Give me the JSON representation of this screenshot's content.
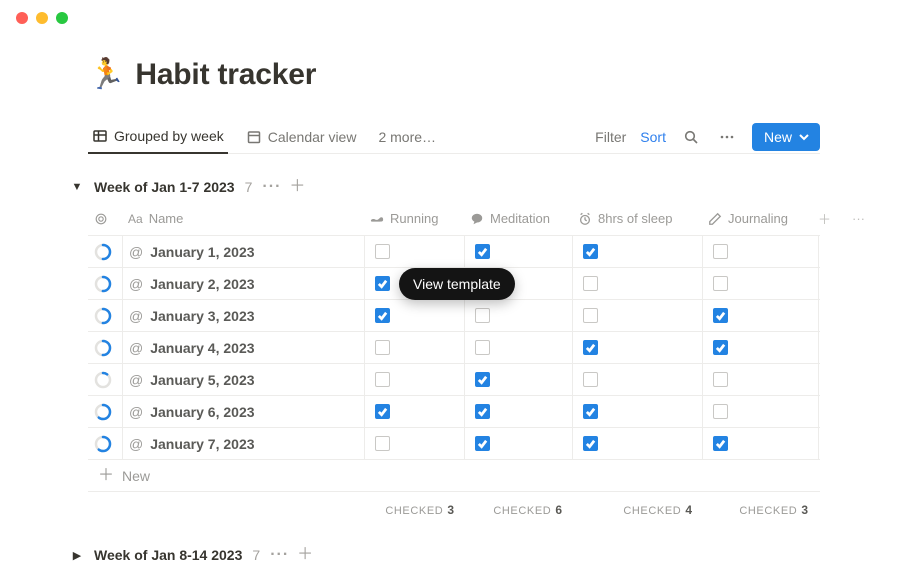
{
  "window": {
    "mac_buttons": true
  },
  "page": {
    "emoji": "🏃",
    "title": "Habit tracker"
  },
  "tabs": {
    "active": {
      "label": "Grouped by week"
    },
    "second": {
      "label": "Calendar view"
    },
    "more": {
      "label": "2 more…"
    }
  },
  "toolbar": {
    "filter": "Filter",
    "sort": "Sort",
    "new": "New"
  },
  "groups": [
    {
      "title": "Week of Jan 1-7 2023",
      "count": "7",
      "expanded": true,
      "columns": {
        "name": "Name",
        "running": "Running",
        "meditation": "Meditation",
        "sleep": "8hrs of sleep",
        "journaling": "Journaling"
      },
      "rows": [
        {
          "date": "January 1, 2023",
          "progress": 0.5,
          "running": false,
          "meditation": true,
          "sleep": true,
          "journaling": false
        },
        {
          "date": "January 2, 2023",
          "progress": 0.5,
          "running": true,
          "meditation": true,
          "sleep": false,
          "journaling": false
        },
        {
          "date": "January 3, 2023",
          "progress": 0.5,
          "running": true,
          "meditation": false,
          "sleep": false,
          "journaling": true
        },
        {
          "date": "January 4, 2023",
          "progress": 0.5,
          "running": false,
          "meditation": false,
          "sleep": true,
          "journaling": true
        },
        {
          "date": "January 5, 2023",
          "progress": 0.1,
          "running": false,
          "meditation": true,
          "sleep": false,
          "journaling": false
        },
        {
          "date": "January 6, 2023",
          "progress": 0.6,
          "running": true,
          "meditation": true,
          "sleep": true,
          "journaling": false
        },
        {
          "date": "January 7, 2023",
          "progress": 0.6,
          "running": false,
          "meditation": true,
          "sleep": true,
          "journaling": true
        }
      ],
      "new_row_label": "New",
      "footers": {
        "label": "CHECKED",
        "running": "3",
        "meditation": "6",
        "sleep": "4",
        "journaling": "3"
      }
    },
    {
      "title": "Week of Jan 8-14 2023",
      "count": "7",
      "expanded": false
    }
  ],
  "tooltip": "View template"
}
